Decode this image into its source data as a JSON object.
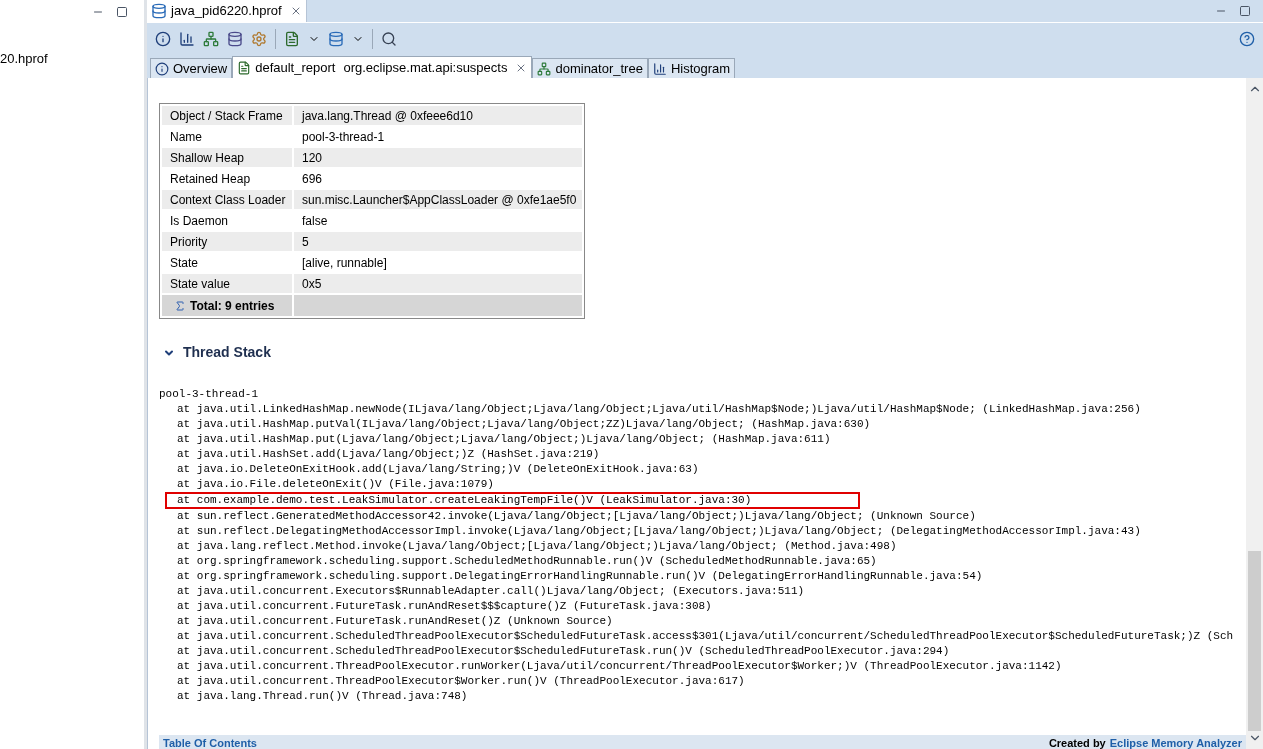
{
  "left_panel": {
    "item": "20.hprof"
  },
  "editor_tab": {
    "title": "java_pid6220.hprof"
  },
  "sub_tabs": [
    {
      "kind": "info",
      "label": "Overview",
      "selected": false
    },
    {
      "kind": "report",
      "label": "default_report",
      "detail": "org.eclipse.mat.api:suspects",
      "selected": true
    },
    {
      "kind": "tree",
      "label": "dominator_tree",
      "selected": false
    },
    {
      "kind": "bars",
      "label": "Histogram",
      "selected": false
    }
  ],
  "properties": {
    "rows": [
      {
        "key": "Object / Stack Frame",
        "value": "java.lang.Thread @ 0xfeee6d10"
      },
      {
        "key": "Name",
        "value": "pool-3-thread-1"
      },
      {
        "key": "Shallow Heap",
        "value": "120"
      },
      {
        "key": "Retained Heap",
        "value": "696"
      },
      {
        "key": "Context Class Loader",
        "value": "sun.misc.Launcher$AppClassLoader @ 0xfe1ae5f0"
      },
      {
        "key": "Is Daemon",
        "value": "false"
      },
      {
        "key": "Priority",
        "value": "5"
      },
      {
        "key": "State",
        "value": "[alive, runnable]"
      },
      {
        "key": "State value",
        "value": "0x5"
      }
    ],
    "total": "Total: 9 entries"
  },
  "thread_stack": {
    "title": "Thread Stack",
    "expanded": true,
    "thread": "pool-3-thread-1",
    "frames": [
      {
        "text": "at java.util.LinkedHashMap.newNode(ILjava/lang/Object;Ljava/lang/Object;Ljava/util/HashMap$Node;)Ljava/util/HashMap$Node; (LinkedHashMap.java:256)",
        "highlighted": false
      },
      {
        "text": "at java.util.HashMap.putVal(ILjava/lang/Object;Ljava/lang/Object;ZZ)Ljava/lang/Object; (HashMap.java:630)",
        "highlighted": false
      },
      {
        "text": "at java.util.HashMap.put(Ljava/lang/Object;Ljava/lang/Object;)Ljava/lang/Object; (HashMap.java:611)",
        "highlighted": false
      },
      {
        "text": "at java.util.HashSet.add(Ljava/lang/Object;)Z (HashSet.java:219)",
        "highlighted": false
      },
      {
        "text": "at java.io.DeleteOnExitHook.add(Ljava/lang/String;)V (DeleteOnExitHook.java:63)",
        "highlighted": false
      },
      {
        "text": "at java.io.File.deleteOnExit()V (File.java:1079)",
        "highlighted": false
      },
      {
        "text": "at com.example.demo.test.LeakSimulator.createLeakingTempFile()V (LeakSimulator.java:30)",
        "highlighted": true
      },
      {
        "text": "at sun.reflect.GeneratedMethodAccessor42.invoke(Ljava/lang/Object;[Ljava/lang/Object;)Ljava/lang/Object; (Unknown Source)",
        "highlighted": false
      },
      {
        "text": "at sun.reflect.DelegatingMethodAccessorImpl.invoke(Ljava/lang/Object;[Ljava/lang/Object;)Ljava/lang/Object; (DelegatingMethodAccessorImpl.java:43)",
        "highlighted": false
      },
      {
        "text": "at java.lang.reflect.Method.invoke(Ljava/lang/Object;[Ljava/lang/Object;)Ljava/lang/Object; (Method.java:498)",
        "highlighted": false
      },
      {
        "text": "at org.springframework.scheduling.support.ScheduledMethodRunnable.run()V (ScheduledMethodRunnable.java:65)",
        "highlighted": false
      },
      {
        "text": "at org.springframework.scheduling.support.DelegatingErrorHandlingRunnable.run()V (DelegatingErrorHandlingRunnable.java:54)",
        "highlighted": false
      },
      {
        "text": "at java.util.concurrent.Executors$RunnableAdapter.call()Ljava/lang/Object; (Executors.java:511)",
        "highlighted": false
      },
      {
        "text": "at java.util.concurrent.FutureTask.runAndReset$$$capture()Z (FutureTask.java:308)",
        "highlighted": false
      },
      {
        "text": "at java.util.concurrent.FutureTask.runAndReset()Z (Unknown Source)",
        "highlighted": false
      },
      {
        "text": "at java.util.concurrent.ScheduledThreadPoolExecutor$ScheduledFutureTask.access$301(Ljava/util/concurrent/ScheduledThreadPoolExecutor$ScheduledFutureTask;)Z (Sch",
        "highlighted": false
      },
      {
        "text": "at java.util.concurrent.ScheduledThreadPoolExecutor$ScheduledFutureTask.run()V (ScheduledThreadPoolExecutor.java:294)",
        "highlighted": false
      },
      {
        "text": "at java.util.concurrent.ThreadPoolExecutor.runWorker(Ljava/util/concurrent/ThreadPoolExecutor$Worker;)V (ThreadPoolExecutor.java:1142)",
        "highlighted": false
      },
      {
        "text": "at java.util.concurrent.ThreadPoolExecutor$Worker.run()V (ThreadPoolExecutor.java:617)",
        "highlighted": false
      },
      {
        "text": "at java.lang.Thread.run()V (Thread.java:748)",
        "highlighted": false
      }
    ]
  },
  "footer": {
    "contents_link": "Table Of Contents",
    "credit": "Created by",
    "credit_link": "Eclipse Memory Analyzer"
  }
}
